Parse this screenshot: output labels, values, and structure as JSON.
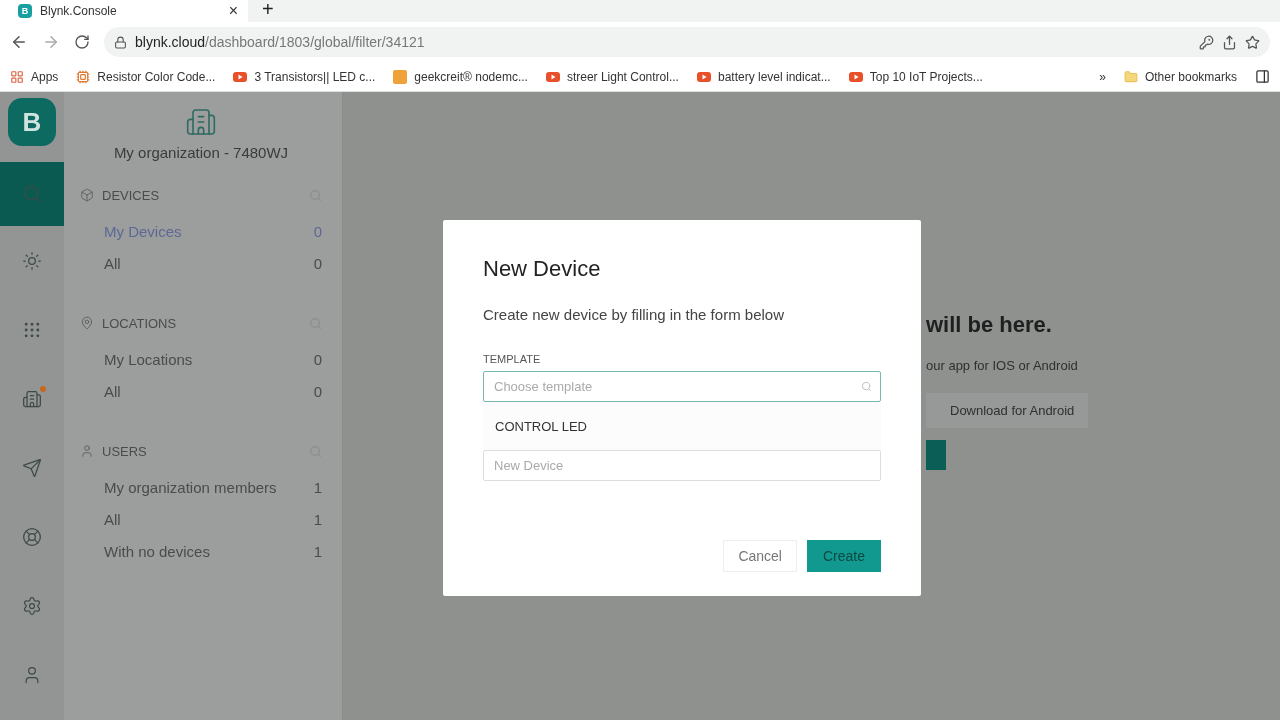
{
  "browser": {
    "tab": {
      "title": "Blynk.Console",
      "favicon": "B",
      "close": "×"
    },
    "new_tab": "+",
    "address": {
      "host": "blynk.cloud",
      "path": "/dashboard/1803/global/filter/34121"
    },
    "bookmarks": [
      {
        "kind": "apps",
        "label": "Apps"
      },
      {
        "kind": "chip",
        "label": "Resistor Color Code..."
      },
      {
        "kind": "video",
        "label": "3 Transistors|| LED c..."
      },
      {
        "kind": "brand",
        "label": "geekcreit® nodemc..."
      },
      {
        "kind": "video",
        "label": "streer Light Control..."
      },
      {
        "kind": "video",
        "label": "battery level indicat..."
      },
      {
        "kind": "video",
        "label": "Top 10 IoT Projects..."
      }
    ],
    "more": "»",
    "other_bookmarks": "Other bookmarks"
  },
  "rail": {
    "logo": "B",
    "items": [
      {
        "kind": "search",
        "selected": true,
        "dot": false
      },
      {
        "kind": "sun",
        "selected": false,
        "dot": false
      },
      {
        "kind": "grid",
        "selected": false,
        "dot": false
      },
      {
        "kind": "building",
        "selected": false,
        "dot": true
      },
      {
        "kind": "send",
        "selected": false,
        "dot": false
      },
      {
        "kind": "lifebuoy",
        "selected": false,
        "dot": false
      },
      {
        "kind": "gear",
        "selected": false,
        "dot": false
      },
      {
        "kind": "user",
        "selected": false,
        "dot": false
      }
    ]
  },
  "sidebar": {
    "organization": "My organization - 7480WJ",
    "sections": [
      {
        "kind": "devices",
        "title": "DEVICES",
        "items": [
          {
            "label": "My Devices",
            "count": "0",
            "selected": true
          },
          {
            "label": "All",
            "count": "0",
            "selected": false
          }
        ]
      },
      {
        "kind": "locations",
        "title": "LOCATIONS",
        "items": [
          {
            "label": "My Locations",
            "count": "0",
            "selected": false
          },
          {
            "label": "All",
            "count": "0",
            "selected": false
          }
        ]
      },
      {
        "kind": "users",
        "title": "USERS",
        "items": [
          {
            "label": "My organization members",
            "count": "1",
            "selected": false
          },
          {
            "label": "All",
            "count": "1",
            "selected": false
          },
          {
            "label": "With no devices",
            "count": "1",
            "selected": false
          }
        ]
      }
    ]
  },
  "background": {
    "heading": "will be here.",
    "subtitle": "our app for IOS or Android",
    "button": "Download for Android"
  },
  "modal": {
    "title": "New Device",
    "description": "Create new device by filling in the form below",
    "template_label": "TEMPLATE",
    "template": {
      "placeholder": "Choose template"
    },
    "options": [
      "CONTROL LED"
    ],
    "name": {
      "placeholder": "New Device"
    },
    "buttons": {
      "cancel": "Cancel",
      "create": "Create"
    }
  }
}
